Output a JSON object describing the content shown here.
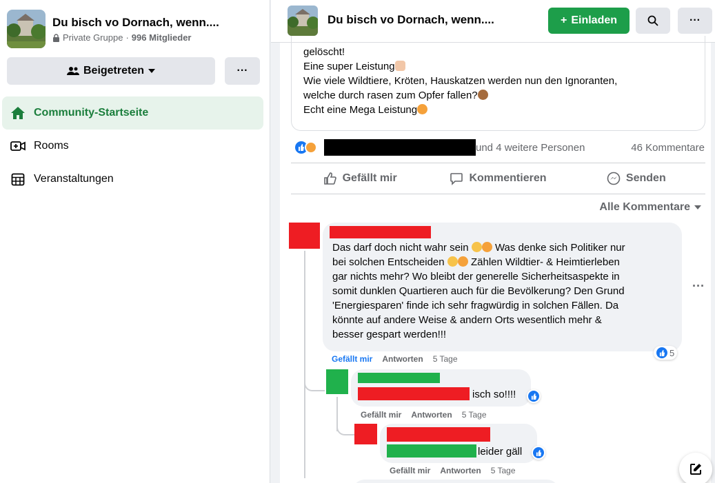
{
  "group": {
    "name": "Du bisch vo Dornach, wenn....",
    "privacy": "Private Gruppe",
    "members": "996 Mitglieder"
  },
  "sidebar": {
    "joined_label": "Beigetreten",
    "more_label": "···",
    "items": [
      {
        "label": "Community-Startseite",
        "icon": "home-icon",
        "active": true
      },
      {
        "label": "Rooms",
        "icon": "video-plus-icon",
        "active": false
      },
      {
        "label": "Veranstaltungen",
        "icon": "calendar-icon",
        "active": false
      }
    ]
  },
  "topbar": {
    "title": "Du bisch vo Dornach, wenn....",
    "invite_label": "Einladen",
    "more_label": "···"
  },
  "post": {
    "lines": [
      "gelöscht!",
      "Eine super Leistung",
      "Wie viele Wildtiere, Kröten, Hauskatzen werden nun den Ignoranten,",
      "welche durch rasen zum Opfer fallen?",
      "Echt eine Mega Leistung"
    ],
    "reactions_others": "und 4 weitere Personen",
    "comments_count": "46 Kommentare",
    "actions": {
      "like": "Gefällt mir",
      "comment": "Kommentieren",
      "send": "Senden"
    },
    "sort_label": "Alle Kommentare"
  },
  "comments": [
    {
      "lines": [
        "Das darf doch nicht wahr sein",
        "Was denke sich Politiker nur",
        "bei solchen Entscheiden",
        "Zählen Wildtier- & Heimtierleben",
        "gar nichts mehr? Wo bleibt der generelle Sicherheitsaspekte in",
        "somit dunklen Quartieren auch für die Bevölkerung? Den Grund",
        "'Energiesparen' finde ich sehr fragwürdig in solchen Fällen. Da",
        "könnte auf andere Weise & andern Orts wesentlich mehr &",
        "besser gespart werden!!!"
      ],
      "like_label": "Gefällt mir",
      "reply_label": "Antworten",
      "time": "5 Tage",
      "reaction_count": "5"
    },
    {
      "text": "isch so!!!!",
      "like_label": "Gefällt mir",
      "reply_label": "Antworten",
      "time": "5 Tage"
    },
    {
      "text": "leider gäll",
      "like_label": "Gefällt mir",
      "reply_label": "Antworten",
      "time": "5 Tage"
    }
  ],
  "colors": {
    "brand_green": "#1d9e4a",
    "redaction_red": "#ee1d23",
    "redaction_green": "#20b14c",
    "like_blue": "#1877f2"
  }
}
